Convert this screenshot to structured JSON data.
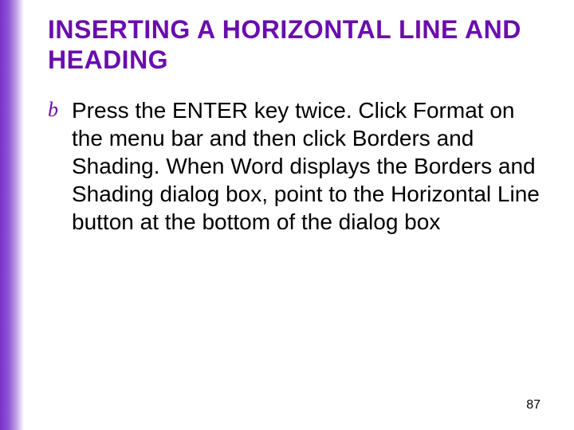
{
  "slide": {
    "title": "INSERTING A HORIZONTAL LINE AND HEADING",
    "bullet_glyph": "b",
    "body": "Press the ENTER key twice.  Click Format on the menu bar and then click Borders and Shading.  When Word displays the Borders and Shading dialog box, point to the Horizontal Line button at the bottom of the dialog box",
    "page_number": "87"
  },
  "colors": {
    "accent": "#6a0dad"
  }
}
